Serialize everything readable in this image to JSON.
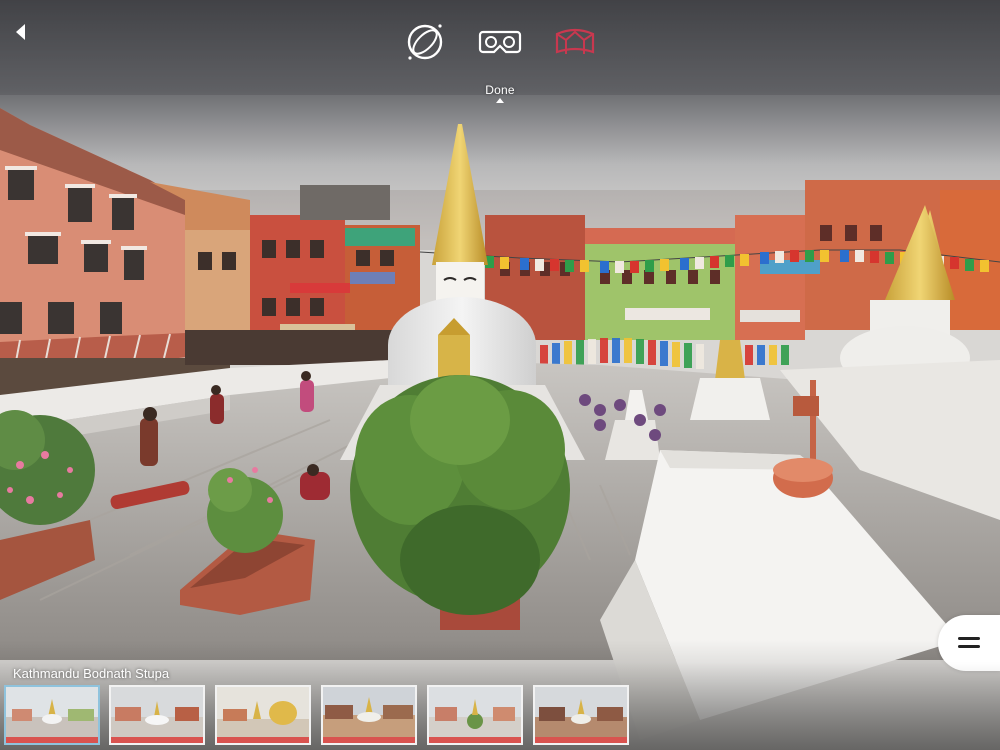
{
  "viewer": {
    "done_label": "Done",
    "active_mode": "little-planet",
    "accent_color": "#c8384f"
  },
  "gallery": {
    "title": "Kathmandu Bodnath Stupa",
    "active_index": 0,
    "thumbnails": [
      {
        "icon": "panorama-thumbnail"
      },
      {
        "icon": "panorama-thumbnail"
      },
      {
        "icon": "panorama-thumbnail"
      },
      {
        "icon": "panorama-thumbnail"
      },
      {
        "icon": "panorama-thumbnail"
      },
      {
        "icon": "panorama-thumbnail"
      }
    ]
  }
}
